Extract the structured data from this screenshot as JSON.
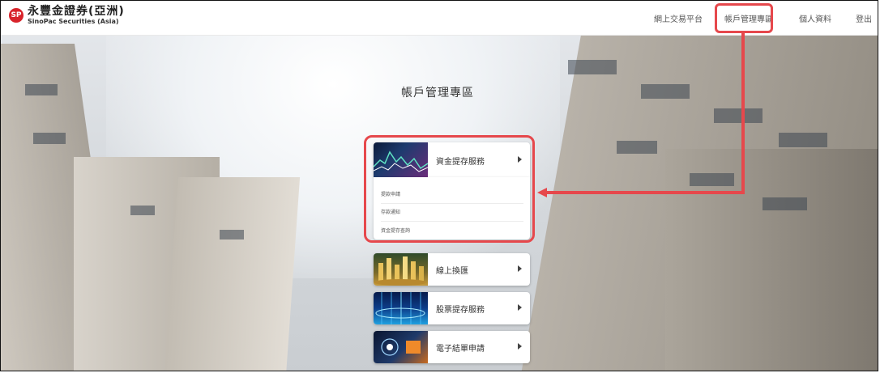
{
  "brand": {
    "name_cn": "永豐金證券(亞洲)",
    "name_en": "SinoPac Securities (Asia)",
    "mark": "SP",
    "color": "#d8232a"
  },
  "nav": {
    "items": [
      "網上交易平台",
      "帳戶管理專區",
      "個人資料",
      "登出"
    ]
  },
  "main": {
    "title": "帳戶管理專區",
    "menu": [
      {
        "label": "資金提存服務",
        "expanded": true,
        "thumb_icon": "stock-chart-icon"
      },
      {
        "label": "線上換匯",
        "expanded": false,
        "thumb_icon": "coins-icon"
      },
      {
        "label": "股票提存服務",
        "expanded": false,
        "thumb_icon": "digital-grid-icon"
      },
      {
        "label": "電子結單申請",
        "expanded": false,
        "thumb_icon": "tech-icon"
      }
    ],
    "submenu": [
      "提款申請",
      "存款通知",
      "資金提存查詢"
    ]
  },
  "highlight_color": "#e6484c"
}
